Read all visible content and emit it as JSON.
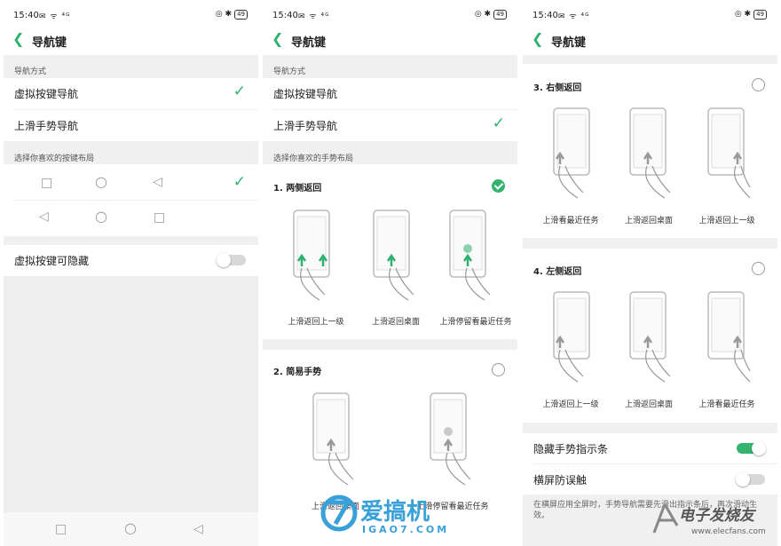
{
  "status": {
    "time": "15:40",
    "battery": "49",
    "left_icons": "✉ ᯤ ⁴ᴳ",
    "right_icons": "◎ ✱"
  },
  "colors": {
    "accent": "#2fb070",
    "divider": "#f0f0f0"
  },
  "panel1": {
    "title": "导航键",
    "section_nav": "导航方式",
    "opt_virtual": "虚拟按键导航",
    "opt_gesture": "上滑手势导航",
    "section_layout": "选择你喜欢的按键布局",
    "hide_keys": "虚拟按键可隐藏",
    "layout1_checked": true,
    "gesture_selected": false,
    "hide_keys_on": false
  },
  "panel2": {
    "title": "导航键",
    "section_nav": "导航方式",
    "opt_virtual": "虚拟按键导航",
    "opt_gesture": "上滑手势导航",
    "section_layout": "选择你喜欢的手势布局",
    "g1_title": "1. 两侧返回",
    "g1_cap1": "上滑返回上一级",
    "g1_cap2": "上滑返回桌面",
    "g1_cap3": "上滑停留看最近任务",
    "g2_title": "2. 简易手势",
    "g2_cap1": "上滑返回桌面",
    "g2_cap2": "上滑停留看最近任务",
    "g1_selected": true,
    "g2_selected": false
  },
  "panel3": {
    "title": "导航键",
    "g3_title": "3. 右侧返回",
    "g3_cap1": "上滑看最近任务",
    "g3_cap2": "上滑返回桌面",
    "g3_cap3": "上滑返回上一级",
    "g4_title": "4. 左侧返回",
    "g4_cap1": "上滑返回上一级",
    "g4_cap2": "上滑返回桌面",
    "g4_cap3": "上滑看最近任务",
    "hide_bar": "隐藏手势指示条",
    "landscape": "横屏防误触",
    "footnote": "在横屏应用全屏时，手势导航需要先滑出指示条后，再次滑动生效。",
    "hide_bar_on": true,
    "landscape_on": false
  },
  "watermarks": {
    "left_brand": "爱搞机",
    "left_domain": "IGAO7.COM",
    "right_brand": "电子发烧友",
    "right_domain": "www.elecfans.com"
  }
}
